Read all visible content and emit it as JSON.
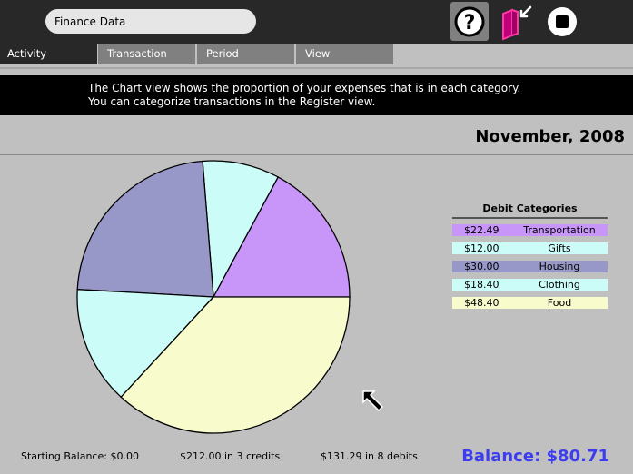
{
  "toolbar": {
    "title": "Finance Data",
    "icons": [
      "help-icon",
      "keep-icon",
      "stop-icon"
    ]
  },
  "tabs": [
    {
      "label": "Activity",
      "active": true
    },
    {
      "label": "Transaction",
      "active": false
    },
    {
      "label": "Period",
      "active": false
    },
    {
      "label": "View",
      "active": false
    }
  ],
  "banner": {
    "line1": "The Chart view shows the proportion of your expenses that is in each category.",
    "line2": "You can categorize transactions in the Register view."
  },
  "period": "November, 2008",
  "legend": {
    "title": "Debit Categories",
    "items": [
      {
        "amount": "$22.49",
        "name": "Transportation",
        "color": "#c896f8"
      },
      {
        "amount": "$12.00",
        "name": "Gifts",
        "color": "#ccfcf8"
      },
      {
        "amount": "$30.00",
        "name": "Housing",
        "color": "#9898c8"
      },
      {
        "amount": "$18.40",
        "name": "Clothing",
        "color": "#ccfcf8"
      },
      {
        "amount": "$48.40",
        "name": "Food",
        "color": "#f8fccc"
      }
    ]
  },
  "chart_data": {
    "type": "pie",
    "title": "",
    "categories": [
      "Transportation",
      "Gifts",
      "Housing",
      "Clothing",
      "Food"
    ],
    "values": [
      22.49,
      12.0,
      30.0,
      18.4,
      48.4
    ],
    "colors": [
      "#c896f8",
      "#ccfcf8",
      "#9898c8",
      "#ccfcf8",
      "#f8fccc"
    ]
  },
  "footer": {
    "starting_balance": "Starting Balance: $0.00",
    "credits": "$212.00 in 3 credits",
    "debits": "$131.29 in 8 debits",
    "balance": "Balance: $80.71"
  }
}
